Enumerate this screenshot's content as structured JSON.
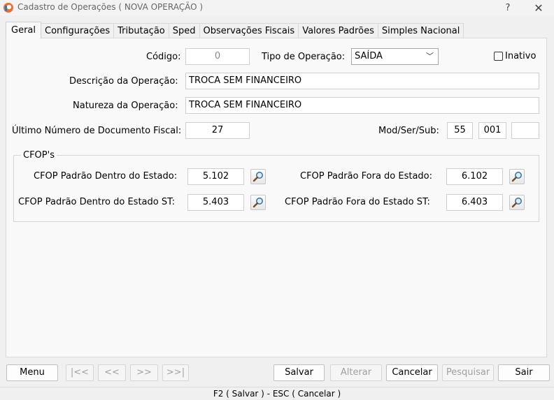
{
  "window": {
    "title": "Cadastro de Operações ( NOVA OPERAÇÃO )",
    "help_label": "?",
    "close_label": "✕"
  },
  "tabs": [
    {
      "label": "Geral"
    },
    {
      "label": "Configurações"
    },
    {
      "label": "Tributação"
    },
    {
      "label": "Sped"
    },
    {
      "label": "Observações Fiscais"
    },
    {
      "label": "Valores Padrões"
    },
    {
      "label": "Simples Nacional"
    }
  ],
  "form": {
    "codigo_label": "Código:",
    "codigo_value": "0",
    "tipo_label": "Tipo de Operação:",
    "tipo_value": "SAÍDA",
    "inativo_label": "Inativo",
    "descricao_label": "Descrição da Operação:",
    "descricao_value": "TROCA SEM FINANCEIRO",
    "natureza_label": "Natureza da Operação:",
    "natureza_value": "TROCA SEM FINANCEIRO",
    "ultimo_label": "Último Número de Documento Fiscal:",
    "ultimo_value": "27",
    "modsersub_label": "Mod/Ser/Sub:",
    "mod_value": "55",
    "ser_value": "001",
    "sub_value": ""
  },
  "cfop": {
    "group_title": "CFOP's",
    "dentro_label": "CFOP Padrão Dentro do Estado:",
    "dentro_value": "5.102",
    "fora_label": "CFOP Padrão Fora do Estado:",
    "fora_value": "6.102",
    "dentro_st_label": "CFOP Padrão Dentro do Estado ST:",
    "dentro_st_value": "5.403",
    "fora_st_label": "CFOP Padrão Fora do Estado ST:",
    "fora_st_value": "6.403"
  },
  "buttons": {
    "menu": "Menu",
    "first": "|<<",
    "prev": "<<",
    "next": ">>",
    "last": ">>|",
    "salvar": "Salvar",
    "alterar": "Alterar",
    "cancelar": "Cancelar",
    "pesquisar": "Pesquisar",
    "sair": "Sair"
  },
  "status": {
    "text": "F2 ( Salvar )  -  ESC ( Cancelar )"
  }
}
